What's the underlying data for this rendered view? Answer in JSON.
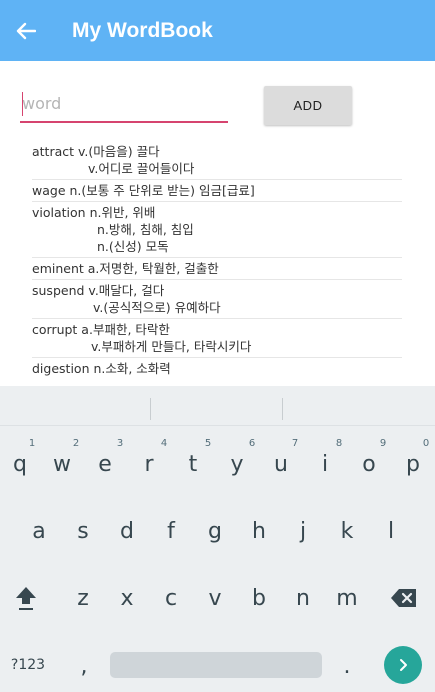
{
  "appbar": {
    "title": "My WordBook",
    "back_icon": "arrow-back-icon",
    "background": "#5fb3f5"
  },
  "form": {
    "word_placeholder": "word",
    "word_value": "",
    "add_label": "ADD",
    "accent": "#d6446f"
  },
  "words": [
    {
      "lines": [
        "attract v.(마음을) 끌다",
        "v.어디로 끌어들이다"
      ]
    },
    {
      "lines": [
        "wage n.(보통 주 단위로 받는) 임금[급료]"
      ]
    },
    {
      "lines": [
        "violation n.위반, 위배",
        "n.방해, 침해, 침입",
        "n.(신성) 모독"
      ]
    },
    {
      "lines": [
        "eminent a.저명한, 탁월한, 걸출한"
      ]
    },
    {
      "lines": [
        "suspend v.매달다, 걸다",
        "v.(공식적으로) 유예하다"
      ]
    },
    {
      "lines": [
        "corrupt a.부패한, 타락한",
        "v.부패하게 만들다, 타락시키다"
      ]
    },
    {
      "lines": [
        "digestion n.소화, 소화력"
      ]
    }
  ],
  "keyboard": {
    "row1": [
      "q",
      "w",
      "e",
      "r",
      "t",
      "y",
      "u",
      "i",
      "o",
      "p"
    ],
    "row1_hints": [
      "1",
      "2",
      "3",
      "4",
      "5",
      "6",
      "7",
      "8",
      "9",
      "0"
    ],
    "row2": [
      "a",
      "s",
      "d",
      "f",
      "g",
      "h",
      "j",
      "k",
      "l"
    ],
    "row3": [
      "z",
      "x",
      "c",
      "v",
      "b",
      "n",
      "m"
    ],
    "shift_icon": "shift-icon",
    "backspace_icon": "backspace-icon",
    "symbols_label": "?123",
    "comma_label": ",",
    "period_label": ".",
    "enter_icon": "chevron-right-icon",
    "enter_color": "#26a69a"
  }
}
